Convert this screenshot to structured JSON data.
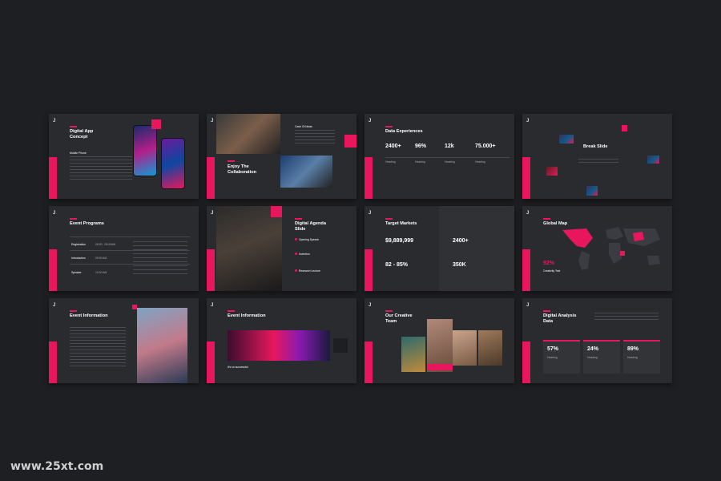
{
  "slides": {
    "s1": {
      "logo": "J",
      "title": "Digital App\nConcept",
      "sub": "Mobile Phone"
    },
    "s2": {
      "logo": "J",
      "title": "Enjoy The\nCollaboration",
      "tag": "Cash Of Ideas"
    },
    "s3": {
      "logo": "J",
      "title": "Data Experiences",
      "stats": [
        "2400+",
        "96%",
        "12k",
        "75.000+"
      ],
      "labels": [
        "Heading",
        "Heading",
        "Heading",
        "Heading"
      ]
    },
    "s4": {
      "logo": "J",
      "title": "Break Slide"
    },
    "s5": {
      "logo": "J",
      "title": "Event Programs",
      "rows": [
        [
          "Registration",
          "08:00 - 09:00AM"
        ],
        [
          "Introduction",
          "09:00 AM"
        ],
        [
          "Speaker",
          "10:00 AM"
        ]
      ]
    },
    "s6": {
      "logo": "J",
      "title": "Digital Agenda\nSlide",
      "items": [
        "Opening Speech",
        "Invention",
        "Research Lecture"
      ]
    },
    "s7": {
      "logo": "J",
      "title": "Target Markets",
      "stats": [
        "$9,889,999",
        "82 - 85%",
        "2400+",
        "350K"
      ]
    },
    "s8": {
      "logo": "J",
      "title": "Global Map",
      "stat": "92%",
      "statlbl": "Creativity Test"
    },
    "s9": {
      "logo": "J",
      "title": "Event Information"
    },
    "s10": {
      "logo": "J",
      "title": "Event Information",
      "sub": "It's so successful"
    },
    "s11": {
      "logo": "J",
      "title": "Our Creative\nTeam"
    },
    "s12": {
      "logo": "J",
      "title": "Digital Analysis\nData",
      "stats": [
        "57%",
        "24%",
        "89%"
      ],
      "labels": [
        "Heading",
        "Heading",
        "Heading"
      ]
    }
  },
  "watermark": "www.25xt.com"
}
